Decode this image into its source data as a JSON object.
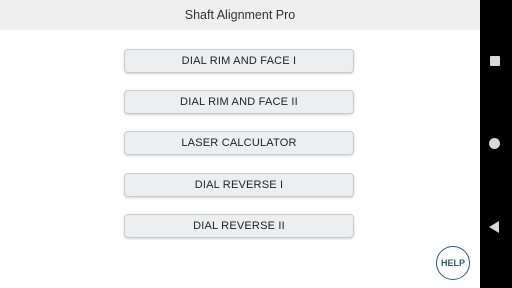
{
  "app": {
    "title": "Shaft Alignment Pro"
  },
  "menu": {
    "items": [
      {
        "label": "DIAL RIM AND FACE I"
      },
      {
        "label": "DIAL RIM AND FACE II"
      },
      {
        "label": "LASER CALCULATOR"
      },
      {
        "label": "DIAL REVERSE I"
      },
      {
        "label": "DIAL REVERSE II"
      }
    ]
  },
  "help": {
    "label": "HELP"
  },
  "system_nav": {
    "icons": [
      "recents-square-icon",
      "home-circle-icon",
      "back-triangle-icon"
    ]
  },
  "colors": {
    "title_bar_bg": "#efefef",
    "button_bg": "#eceef0",
    "help_accent": "#2f5a8a",
    "nav_bar_bg": "#000000"
  }
}
